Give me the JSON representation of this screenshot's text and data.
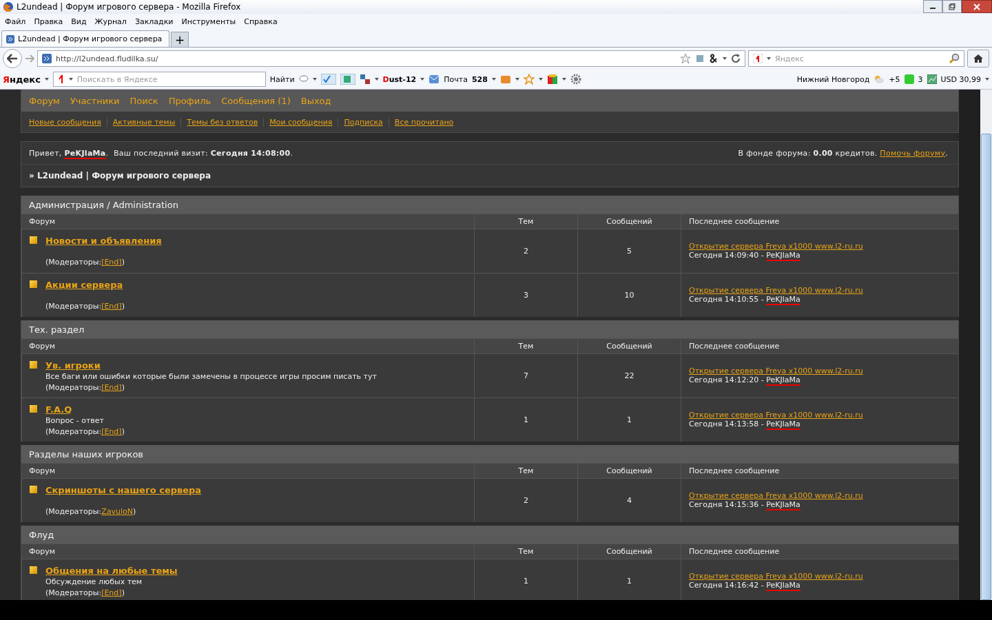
{
  "window": {
    "title": "L2undead | Форум игрового сервера - Mozilla Firefox"
  },
  "menu": [
    "Файл",
    "Правка",
    "Вид",
    "Журнал",
    "Закладки",
    "Инструменты",
    "Справка"
  ],
  "tabs": [
    {
      "label": "L2undead | Форум игрового сервера",
      "selected": true
    }
  ],
  "new_tab": "+",
  "address": {
    "value": "http://l2undead.fludilka.su/"
  },
  "browser_search": {
    "placeholder": "Яндекс"
  },
  "yandex_bar": {
    "logo": "Яндекс",
    "search_placeholder": "Поискать в Яндексе",
    "find": "Найти",
    "user": "Dust-12",
    "mail": "Почта",
    "mail_count": "528",
    "city": "Нижний Новгород",
    "weather": "+5",
    "traffic": "3",
    "currency": "USD 30,99"
  },
  "forum_nav": [
    "Форум",
    "Участники",
    "Поиск",
    "Профиль",
    "Сообщения (1)",
    "Выход"
  ],
  "forum_subnav": [
    "Новые сообщения",
    "Активные темы",
    "Темы без ответов",
    "Мои сообщения",
    "Подписка",
    "Все прочитано"
  ],
  "greeting": "Привет, **PeKJlaMa**.  Ваш последний визит: **Сегодня 14:08:00**.",
  "fund": {
    "text": "В фонде форума: **0.00** кредитов.",
    "link": "Помочь форуму",
    "end": "."
  },
  "breadcrumb": "» L2undead | Форум игрового сервера",
  "categories": [
    {
      "title": "Администрация / Administration",
      "columns": [
        "Форум",
        "Тем",
        "Сообщений",
        "Последнее сообщение"
      ],
      "forums": [
        {
          "name": "Новости и объявления",
          "moderators": "(Модераторы: ",
          "moderator": "[End]",
          "close": ")",
          "topics": "2",
          "posts": "5",
          "last_title": "Открытие сервера Freya x1000 www.l2-ru.ru",
          "last_time": "Сегодня 14:09:40 - ",
          "last_author": "PeKJlaMa"
        },
        {
          "name": "Акции сервера",
          "moderators": "(Модераторы: ",
          "moderator": "[End]",
          "close": ")",
          "topics": "3",
          "posts": "10",
          "last_title": "Открытие сервера Freya x1000 www.l2-ru.ru",
          "last_time": "Сегодня 14:10:55 - ",
          "last_author": "PeKJlaMa"
        }
      ]
    },
    {
      "title": "Тех. раздел",
      "columns": [
        "Форум",
        "Тем",
        "Сообщений",
        "Последнее сообщение"
      ],
      "forums": [
        {
          "name": "Ув. игроки",
          "description": "Все баги или ошибки которые были замечены в процессе игры просим писать тут",
          "moderators": "(Модераторы: ",
          "moderator": "[End]",
          "close": ")",
          "topics": "7",
          "posts": "22",
          "last_title": "Открытие сервера Freya x1000 www.l2-ru.ru",
          "last_time": "Сегодня 14:12:20 - ",
          "last_author": "PeKJlaMa"
        },
        {
          "name": "F.A.Q",
          "description": "Вопрос - ответ",
          "moderators": "(Модераторы: ",
          "moderator": "[End]",
          "close": ")",
          "topics": "1",
          "posts": "1",
          "last_title": "Открытие сервера Freya x1000 www.l2-ru.ru",
          "last_time": "Сегодня 14:13:58 - ",
          "last_author": "PeKJlaMa"
        }
      ]
    },
    {
      "title": "Разделы наших игроков",
      "columns": [
        "Форум",
        "Тем",
        "Сообщений",
        "Последнее сообщение"
      ],
      "forums": [
        {
          "name": "Скриншоты с нашего сервера",
          "moderators": "(Модераторы: ",
          "moderator": "ZavuloN",
          "close": ")",
          "topics": "2",
          "posts": "4",
          "last_title": "Открытие сервера Freya x1000 www.l2-ru.ru",
          "last_time": "Сегодня 14:15:36 - ",
          "last_author": "PeKJlaMa"
        }
      ]
    },
    {
      "title": "Флуд",
      "columns": [
        "Форум",
        "Тем",
        "Сообщений",
        "Последнее сообщение"
      ],
      "forums": [
        {
          "name": "Общения на любые темы",
          "description": "Обсуждение любых тем",
          "moderators": "(Модераторы: ",
          "moderator": "[End]",
          "close": ")",
          "topics": "1",
          "posts": "1",
          "last_title": "Открытие сервера Freya x1000 www.l2-ru.ru",
          "last_time": "Сегодня 14:16:42 - ",
          "last_author": "PeKJlaMa"
        }
      ]
    }
  ]
}
